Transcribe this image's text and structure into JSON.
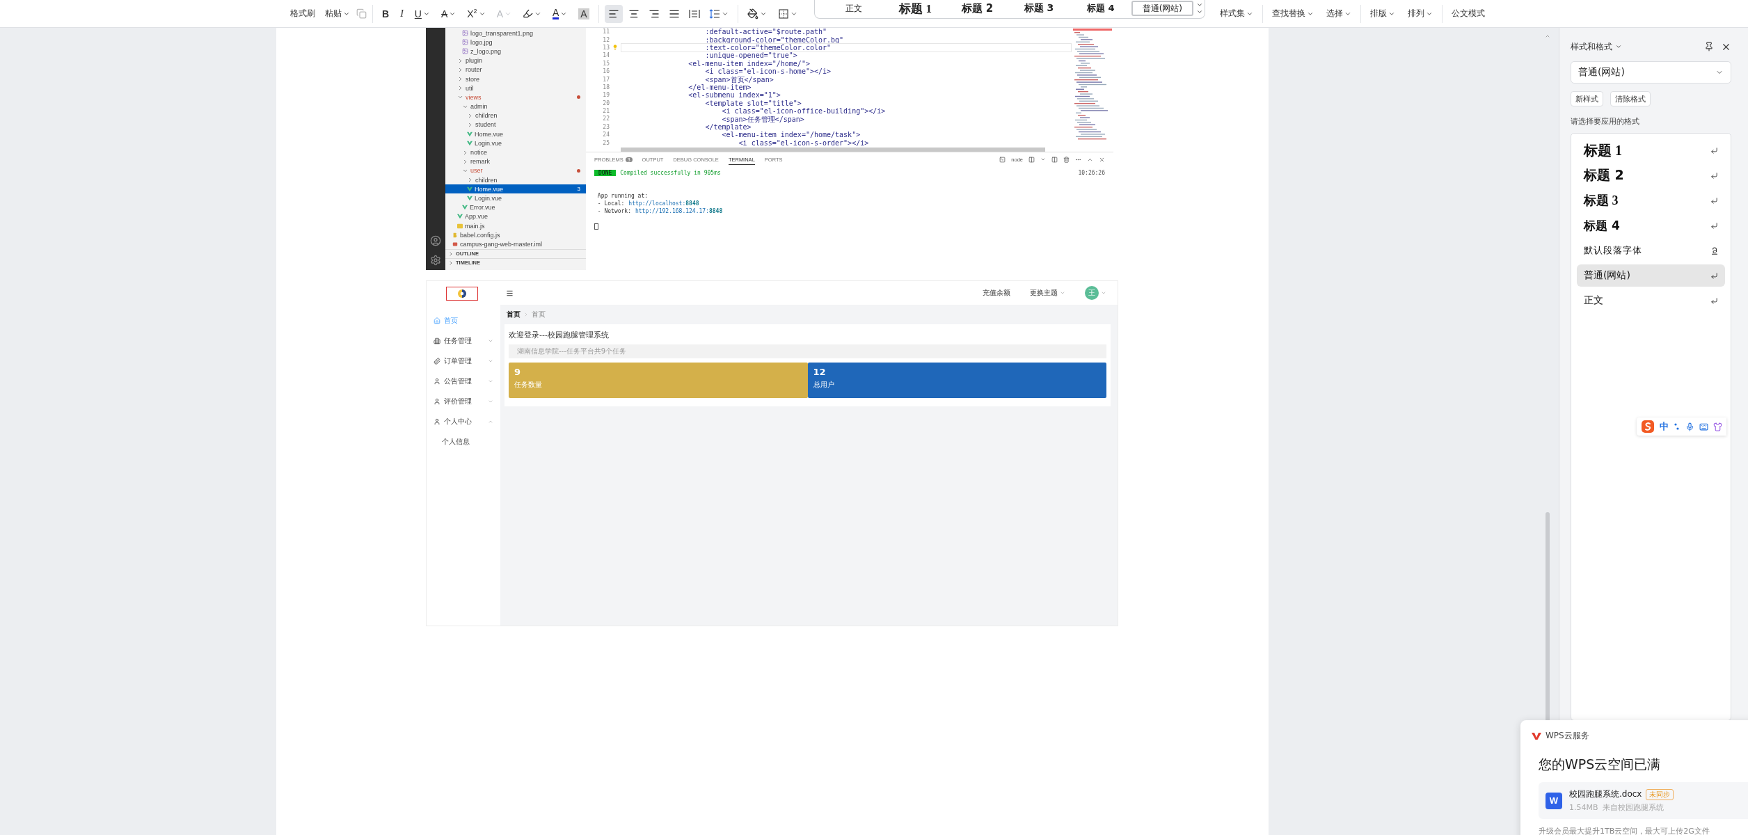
{
  "toolbar": {
    "clipboard": [
      {
        "label": "格式刷",
        "dropdown": false
      },
      {
        "label": "粘贴",
        "dropdown": true
      }
    ],
    "font_buttons": [
      {
        "label": "B",
        "kind": "bold",
        "dropdown": false,
        "disabled": false
      },
      {
        "label": "I",
        "kind": "italic",
        "dropdown": false,
        "disabled": false
      },
      {
        "label": "U",
        "kind": "underline",
        "dropdown": true,
        "disabled": false
      },
      {
        "label": "A",
        "kind": "strike",
        "dropdown": true,
        "disabled": false
      },
      {
        "label": "X$^{2}$",
        "kind": "plain",
        "dropdown": true,
        "disabled": false
      },
      {
        "label": "A",
        "kind": "outline",
        "dropdown": true,
        "disabled": true
      },
      {
        "kind": "highlight",
        "dropdown": true,
        "disabled": false
      },
      {
        "label": "A",
        "kind": "color",
        "dropdown": true,
        "disabled": false
      },
      {
        "label": "A",
        "kind": "shaded",
        "dropdown": false,
        "disabled": false
      }
    ],
    "paragraph_buttons": [
      {
        "kind": "align-left",
        "selected": true,
        "dropdown": false
      },
      {
        "kind": "align-center",
        "selected": false,
        "dropdown": false
      },
      {
        "kind": "align-right",
        "selected": false,
        "dropdown": false
      },
      {
        "kind": "justify",
        "selected": false,
        "dropdown": false
      },
      {
        "kind": "distributed",
        "selected": false,
        "dropdown": false
      },
      {
        "kind": "line-spacing",
        "selected": false,
        "dropdown": true
      }
    ],
    "border_buttons": [
      {
        "kind": "shading",
        "dropdown": true
      },
      {
        "kind": "borders",
        "dropdown": true
      }
    ],
    "style_gallery": [
      {
        "label": "正文",
        "kind": "body",
        "selected": false
      },
      {
        "label": "标题 1",
        "kind": "h1",
        "selected": false
      },
      {
        "label": "标题 2",
        "kind": "h2",
        "selected": false
      },
      {
        "label": "标题 3",
        "kind": "h3",
        "selected": false
      },
      {
        "label": "标题 4",
        "kind": "h4",
        "selected": false
      },
      {
        "label": "普通(网站)",
        "kind": "body",
        "selected": true
      }
    ],
    "command_groups": [
      [
        {
          "label": "样式集",
          "dropdown": true
        }
      ],
      [
        {
          "label": "查找替换",
          "dropdown": true
        },
        {
          "label": "选择",
          "dropdown": true
        }
      ],
      [
        {
          "label": "排版",
          "dropdown": true
        },
        {
          "label": "排列",
          "dropdown": true
        }
      ],
      [
        {
          "label": "公文模式",
          "dropdown": false
        }
      ]
    ]
  },
  "document": {
    "editor_screenshot": {
      "tree": [
        {
          "children": [
            {
              "children": [
                {
                  "label": "logo_transparent1.png",
                  "kind": "image",
                  "selected": false,
                  "modified": false
                },
                {
                  "label": "logo.jpg",
                  "kind": "image",
                  "selected": false,
                  "modified": false
                },
                {
                  "label": "z_logo.png",
                  "kind": "image",
                  "selected": false,
                  "modified": false
                }
              ]
            },
            {
              "label": "plugin",
              "kind": "folder",
              "expanded": false,
              "selected": false,
              "modified": false
            },
            {
              "label": "router",
              "kind": "folder",
              "expanded": false,
              "selected": false,
              "modified": false
            },
            {
              "label": "store",
              "kind": "folder",
              "expanded": false,
              "selected": false,
              "modified": false
            },
            {
              "label": "util",
              "kind": "folder",
              "expanded": false,
              "selected": false,
              "modified": false
            },
            {
              "label": "views",
              "kind": "folder",
              "expanded": true,
              "selected": false,
              "modified": true,
              "children": [
                {
                  "label": "admin",
                  "kind": "folder",
                  "expanded": true,
                  "selected": false,
                  "modified": false,
                  "children": [
                    {
                      "label": "children",
                      "kind": "folder",
                      "expanded": false,
                      "selected": false,
                      "modified": false
                    },
                    {
                      "label": "student",
                      "kind": "folder",
                      "expanded": false,
                      "selected": false,
                      "modified": false
                    },
                    {
                      "label": "Home.vue",
                      "kind": "vue",
                      "selected": false,
                      "modified": false
                    },
                    {
                      "label": "Login.vue",
                      "kind": "vue",
                      "selected": false,
                      "modified": false
                    }
                  ]
                },
                {
                  "label": "notice",
                  "kind": "folder",
                  "expanded": false,
                  "selected": false,
                  "modified": false
                },
                {
                  "label": "remark",
                  "kind": "folder",
                  "expanded": false,
                  "selected": false,
                  "modified": false
                },
                {
                  "label": "user",
                  "kind": "folder",
                  "expanded": true,
                  "selected": false,
                  "modified": true,
                  "children": [
                    {
                      "label": "children",
                      "kind": "folder",
                      "expanded": false,
                      "selected": false,
                      "modified": false
                    },
                    {
                      "label": "Home.vue",
                      "kind": "vue",
                      "selected": true,
                      "modified": false,
                      "badge": "3"
                    },
                    {
                      "label": "Login.vue",
                      "kind": "vue",
                      "selected": false,
                      "modified": false
                    }
                  ]
                },
                {
                  "label": "Error.vue",
                  "kind": "vue",
                  "selected": false,
                  "modified": false
                }
              ]
            },
            {
              "label": "App.vue",
              "kind": "vue",
              "selected": false,
              "modified": false
            },
            {
              "label": "main.js",
              "kind": "js",
              "selected": false,
              "modified": false
            }
          ]
        },
        {
          "label": "babel.config.js",
          "kind": "babel",
          "selected": false,
          "modified": false
        },
        {
          "label": "campus-gang-web-master.iml",
          "kind": "file",
          "selected": false,
          "modified": false
        }
      ],
      "sections": [
        {
          "label": "OUTLINE",
          "expanded": false
        },
        {
          "label": "TIMELINE",
          "expanded": false
        }
      ],
      "code": [
        {
          "line": "11",
          "text": "                    :default-active=\"$route.path\"",
          "current": false
        },
        {
          "line": "12",
          "text": "                    :background-color=\"themeColor.bg\"",
          "current": false
        },
        {
          "line": "13",
          "text": "                    :text-color=\"themeColor.color\"",
          "current": true
        },
        {
          "line": "14",
          "text": "                    :unique-opened=\"true\">",
          "current": false
        },
        {
          "line": "15",
          "text": "                <el-menu-item index=\"/home/\">",
          "current": false
        },
        {
          "line": "16",
          "text": "                    <i class=\"el-icon-s-home\"></i>",
          "current": false
        },
        {
          "line": "17",
          "text": "                    <span>首页</span>",
          "current": false
        },
        {
          "line": "18",
          "text": "                </el-menu-item>",
          "current": false
        },
        {
          "line": "19",
          "text": "                <el-submenu index=\"1\">",
          "current": false
        },
        {
          "line": "20",
          "text": "                    <template slot=\"title\">",
          "current": false
        },
        {
          "line": "21",
          "text": "                        <i class=\"el-icon-office-building\"></i>",
          "current": false
        },
        {
          "line": "22",
          "text": "                        <span>任务管理</span>",
          "current": false
        },
        {
          "line": "23",
          "text": "                    </template>",
          "current": false
        },
        {
          "line": "24",
          "text": "                        <el-menu-item index=\"/home/task\">",
          "current": false
        },
        {
          "line": "25",
          "text": "                            <i class=\"el-icon-s-order\"></i>",
          "current": false
        }
      ],
      "panel_tabs": [
        {
          "label": "PROBLEMS",
          "badge": "3",
          "selected": false
        },
        {
          "label": "OUTPUT",
          "selected": false
        },
        {
          "label": "DEBUG CONSOLE",
          "selected": false
        },
        {
          "label": "TERMINAL",
          "selected": true
        },
        {
          "label": "PORTS",
          "selected": false
        }
      ],
      "terminal_name": "node",
      "terminal": {
        "status": "DONE",
        "message": "Compiled successfully in 905ms",
        "time": "10:26:26",
        "heading": "App running at:",
        "urls": [
          {
            "label": "- Local:",
            "url": "http://localhost:**8848**"
          },
          {
            "label": "- Network:",
            "url": "http://192.168.124.17:**8848**"
          }
        ]
      }
    },
    "app_screenshot": {
      "menu": [
        {
          "label": "首页",
          "kind": "item",
          "selected": true
        },
        {
          "label": "任务管理",
          "kind": "submenu",
          "expanded": false,
          "selected": false
        },
        {
          "label": "订单管理",
          "kind": "submenu",
          "expanded": false,
          "selected": false
        },
        {
          "label": "公告管理",
          "kind": "submenu",
          "expanded": false,
          "selected": false
        },
        {
          "label": "评价管理",
          "kind": "submenu",
          "expanded": false,
          "selected": false
        },
        {
          "label": "个人中心",
          "kind": "submenu",
          "expanded": true,
          "selected": false,
          "children": [
            {
              "label": "个人信息",
              "selected": false
            }
          ]
        }
      ],
      "header_actions": [
        {
          "label": "充值余额",
          "dropdown": false
        },
        {
          "label": "更换主题",
          "dropdown": true
        }
      ],
      "avatar": "王",
      "breadcrumb": [
        "首页",
        "首页"
      ],
      "welcome": "欢迎登录---校园跑腿管理系统",
      "notice": "湖南信息学院---任务平台共9个任务",
      "stats": [
        {
          "value": "9",
          "label": "任务数量",
          "color": "#d4b04a"
        },
        {
          "value": "12",
          "label": "总用户",
          "color": "#1f67b9"
        }
      ]
    }
  },
  "styles_panel": {
    "title": "样式和格式",
    "current_style": "普通(网站)",
    "buttons": [
      "新样式",
      "清除格式"
    ],
    "prompt": "请选择要应用的格式",
    "styles": [
      {
        "label": "标题 1",
        "kind": "h1",
        "selected": false
      },
      {
        "label": "标题 2",
        "kind": "h2",
        "selected": false
      },
      {
        "label": "标题 3",
        "kind": "h3",
        "selected": false
      },
      {
        "label": "标题 4",
        "kind": "h4",
        "selected": false
      },
      {
        "label": "默认段落字体",
        "kind": "char",
        "selected": false
      },
      {
        "label": "普通(网站)",
        "kind": "para",
        "selected": true
      },
      {
        "label": "正文",
        "kind": "para",
        "selected": false
      }
    ]
  },
  "ime": {
    "mode": "中"
  },
  "cloud_popup": {
    "service": "WPS云服务",
    "heading": "您的WPS云空间已满",
    "file": {
      "icon_letter": "W",
      "name": "校园跑腿系统.docx",
      "badge": "未同步",
      "size": "1.54MB",
      "source": "来自校园跑腿系统"
    },
    "note": "升级会员最大提升1TB云空间，最大可上传2G文件"
  }
}
